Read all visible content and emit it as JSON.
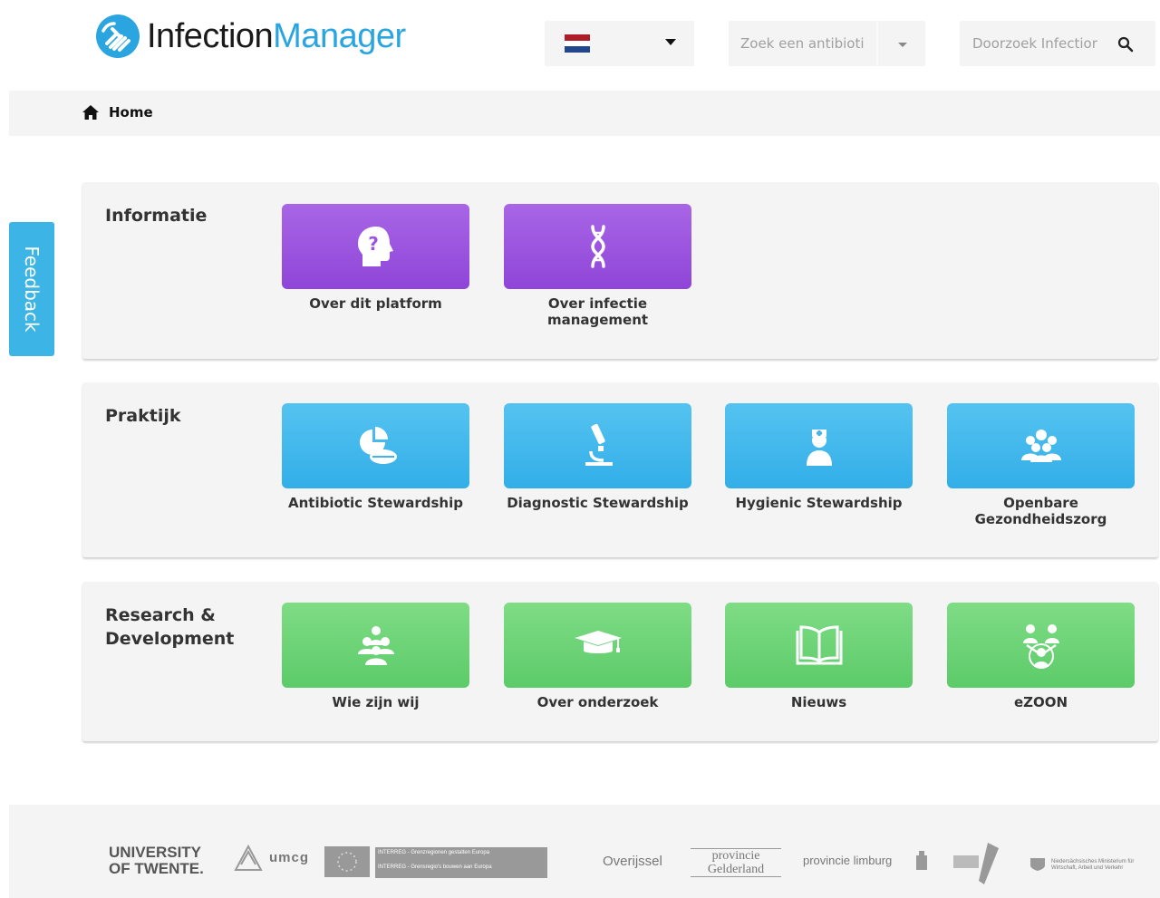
{
  "header": {
    "logo_part1": "Infection",
    "logo_part2": "Manager",
    "language": "nl",
    "antibiotic_search_placeholder": "Zoek een antibioti",
    "site_search_placeholder": "Doorzoek Infectior"
  },
  "breadcrumb": {
    "home_label": "Home"
  },
  "feedback_label": "Feedback",
  "colors": {
    "brand_blue": "#2aa5df",
    "purple_tile": "#9b55de",
    "blue_tile": "#3db5eb",
    "green_tile": "#6ad275"
  },
  "sections": [
    {
      "title": "Informatie",
      "tiles": [
        {
          "label": "Over dit platform",
          "icon": "head-question-icon",
          "color": "purple"
        },
        {
          "label": "Over infectie management",
          "icon": "dna-icon",
          "color": "purple"
        }
      ]
    },
    {
      "title": "Praktijk",
      "tiles": [
        {
          "label": "Antibiotic Stewardship",
          "icon": "pills-icon",
          "color": "blue"
        },
        {
          "label": "Diagnostic Stewardship",
          "icon": "microscope-icon",
          "color": "blue"
        },
        {
          "label": "Hygienic Stewardship",
          "icon": "nurse-icon",
          "color": "blue"
        },
        {
          "label": "Openbare Gezondheidszorg",
          "icon": "people-group-icon",
          "color": "blue"
        }
      ]
    },
    {
      "title": "Research & Development",
      "tiles": [
        {
          "label": "Wie zijn wij",
          "icon": "team-icon",
          "color": "green"
        },
        {
          "label": "Over onderzoek",
          "icon": "graduation-cap-icon",
          "color": "green"
        },
        {
          "label": "Nieuws",
          "icon": "book-open-icon",
          "color": "green"
        },
        {
          "label": "eZOON",
          "icon": "network-icon",
          "color": "green"
        }
      ]
    }
  ],
  "footer": {
    "sponsors": [
      "UNIVERSITY OF TWENTE.",
      "umcg",
      "INTERREG - Grenzregionen gestalten Europa",
      "INTERREG - Grensregio's bouwen aan Europa",
      "Overijssel",
      "provincie Gelderland",
      "provincie limburg",
      "Niedersächsisches Ministerium für Wirtschaft, Arbeit und Verkehr"
    ]
  }
}
